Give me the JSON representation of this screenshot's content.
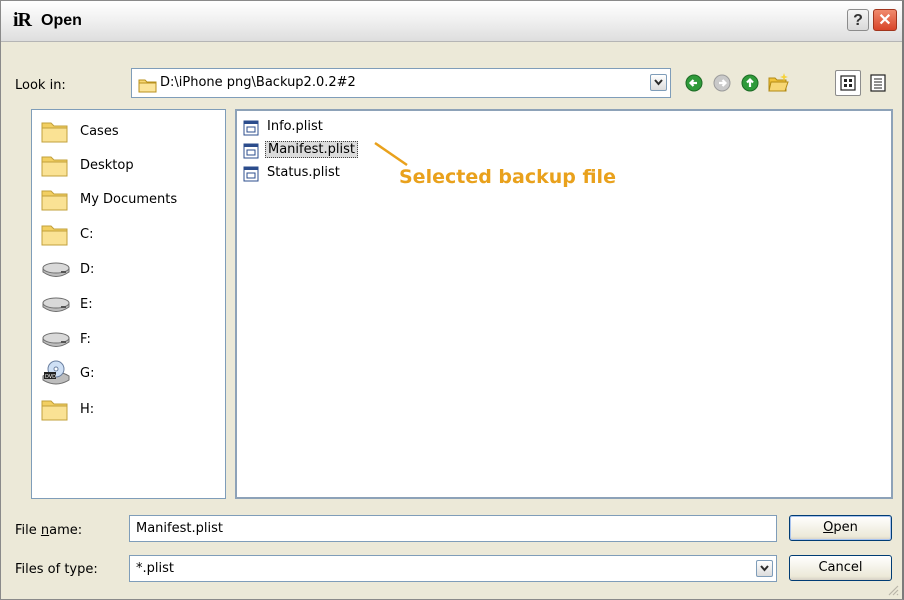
{
  "window": {
    "app_icon": "iR",
    "title": "Open",
    "help_glyph": "?",
    "close_glyph": "✕"
  },
  "lookin": {
    "label": "Look in:",
    "path": "D:\\iPhone png\\Backup2.0.2#2"
  },
  "toolbar": {
    "icons": [
      "back-icon",
      "forward-icon",
      "up-folder-icon",
      "new-folder-icon",
      "thumbnail-view-icon",
      "list-view-icon"
    ]
  },
  "places": [
    {
      "label": "Cases",
      "icon": "folder-icon"
    },
    {
      "label": "Desktop",
      "icon": "folder-icon"
    },
    {
      "label": "My Documents",
      "icon": "folder-icon"
    },
    {
      "label": "C:",
      "icon": "folder-icon"
    },
    {
      "label": "D:",
      "icon": "drive-icon"
    },
    {
      "label": "E:",
      "icon": "drive-icon"
    },
    {
      "label": "F:",
      "icon": "drive-icon"
    },
    {
      "label": "G:",
      "icon": "dvd-drive-icon"
    },
    {
      "label": "H:",
      "icon": "folder-icon"
    }
  ],
  "files": [
    {
      "name": "Info.plist",
      "selected": false
    },
    {
      "name": "Manifest.plist",
      "selected": true
    },
    {
      "name": "Status.plist",
      "selected": false
    }
  ],
  "annotation": {
    "text": "Selected backup file",
    "color": "#e9a11c"
  },
  "form": {
    "file_name_label_pre": "File ",
    "file_name_label_u": "n",
    "file_name_label_post": "ame:",
    "file_name_value": "Manifest.plist",
    "file_type_label": "Files of type:",
    "file_type_value": "*.plist",
    "open_label_u": "O",
    "open_label_post": "pen",
    "cancel_label": "Cancel"
  }
}
